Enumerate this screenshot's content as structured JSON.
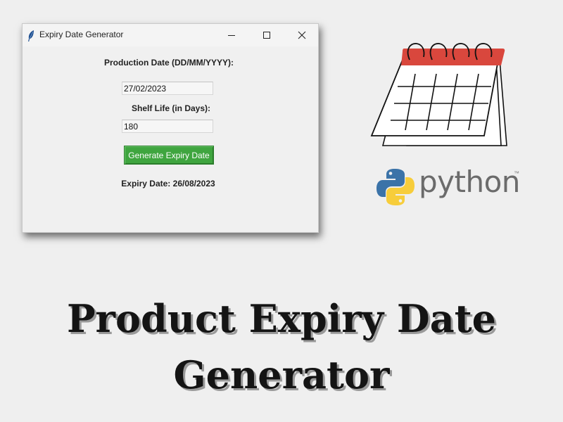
{
  "window": {
    "title": "Expiry Date Generator",
    "app_icon": "feather-icon",
    "controls": [
      "minimize-icon",
      "maximize-icon",
      "close-icon"
    ]
  },
  "form": {
    "production_label": "Production Date (DD/MM/YYYY):",
    "production_value": "27/02/2023",
    "shelf_label": "Shelf Life (in Days):",
    "shelf_value": "180",
    "generate_button": "Generate Expiry Date",
    "result": "Expiry Date: 26/08/2023",
    "button_color": "#3fa53f"
  },
  "artwork": {
    "calendar_icon": "calendar-icon",
    "calendar_accent": "#d9473d",
    "python_logo": "python-logo-icon",
    "python_word": "python",
    "python_tm": "™"
  },
  "heading": {
    "line1": "Product Expiry Date",
    "line2": "Generator"
  }
}
